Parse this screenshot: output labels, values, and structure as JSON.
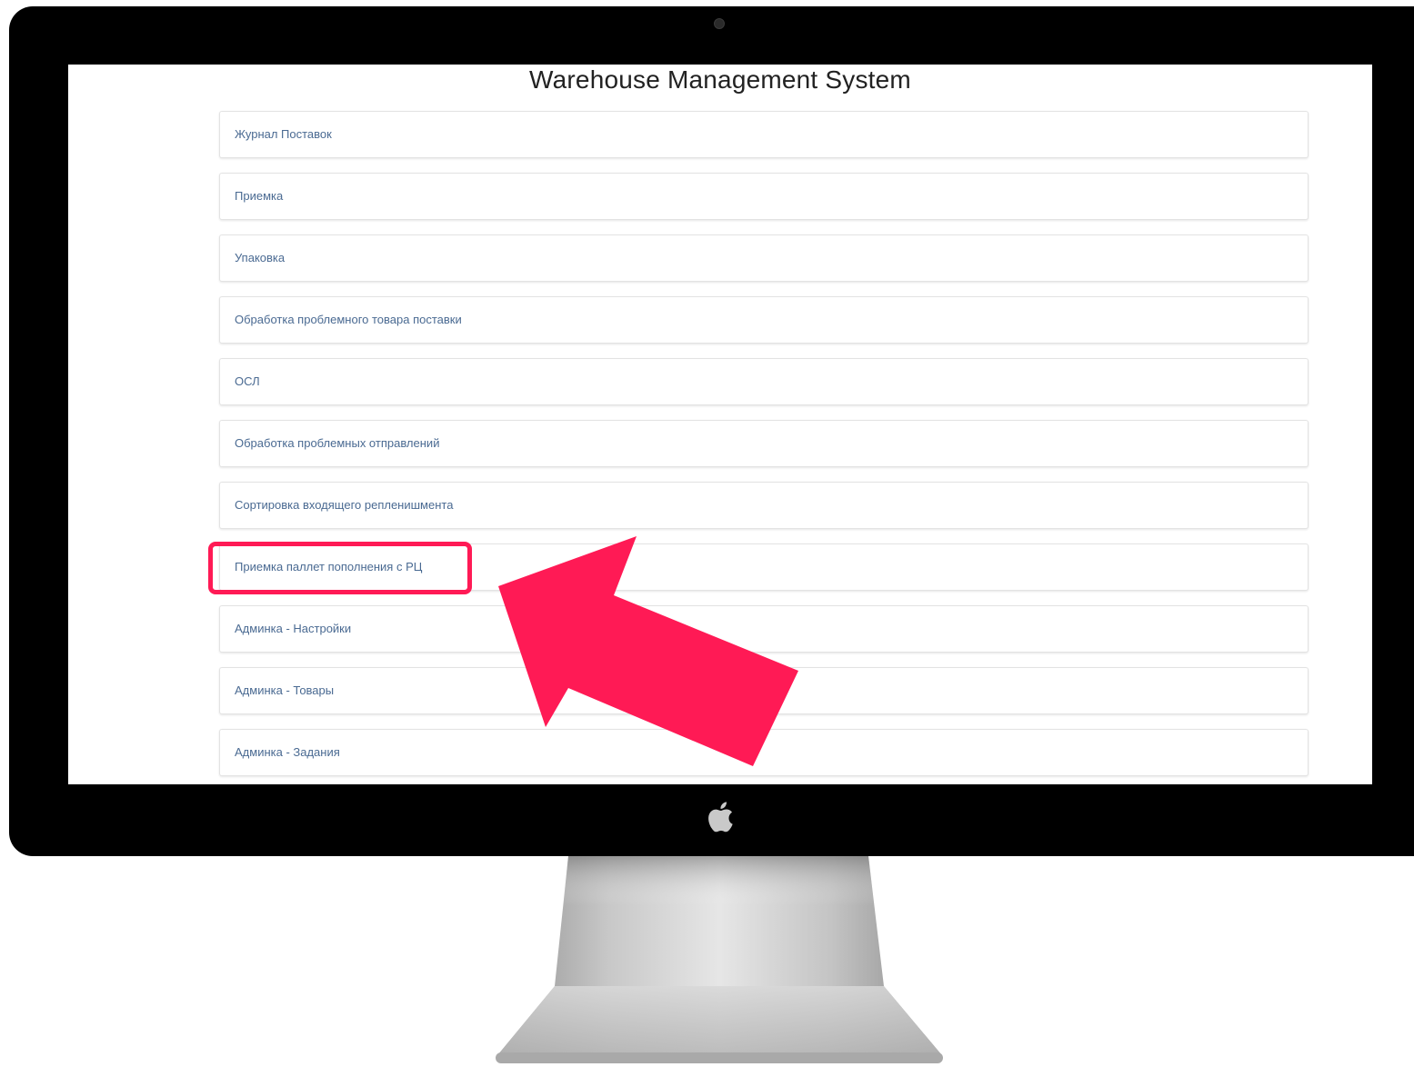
{
  "app": {
    "title": "Warehouse Management System"
  },
  "menu": {
    "items": [
      {
        "label": "Журнал Поставок"
      },
      {
        "label": "Приемка"
      },
      {
        "label": "Упаковка"
      },
      {
        "label": "Обработка проблемного товара поставки"
      },
      {
        "label": "ОСЛ"
      },
      {
        "label": "Обработка проблемных отправлений"
      },
      {
        "label": "Сортировка входящего репленишмента"
      },
      {
        "label": "Приемка паллет пополнения с РЦ"
      },
      {
        "label": "Админка - Настройки"
      },
      {
        "label": "Админка - Товары"
      },
      {
        "label": "Админка - Задания"
      }
    ]
  },
  "annotation": {
    "highlighted_item": "Приемка паллет пополнения с РЦ",
    "color": "#ff1a55"
  },
  "colors": {
    "bezel": "#000000",
    "link_text": "#4a6a92",
    "card_border": "#e3e3e3"
  },
  "icons": {
    "brand_logo": "apple-logo-icon",
    "pointer": "arrow-icon"
  }
}
